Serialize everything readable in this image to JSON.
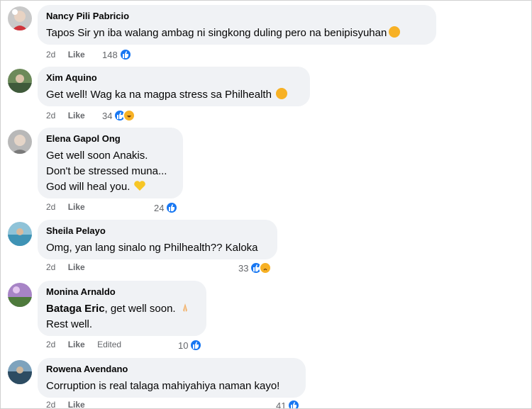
{
  "comments": [
    {
      "author": "Nancy Pili Pabricio",
      "lines": [
        "Tapos Sir yn iba walang ambag ni singkong duling pero na benipisyuhan"
      ],
      "time": "2d",
      "like": "Like",
      "count": "148",
      "reactions": [
        "like"
      ],
      "emoji": "crying-face"
    },
    {
      "author": "Xim Aquino",
      "lines": [
        "Get well! Wag ka na magpa stress sa Philhealth"
      ],
      "time": "2d",
      "like": "Like",
      "count": "34",
      "reactions": [
        "like",
        "haha"
      ],
      "emoji": "smiling-face"
    },
    {
      "author": "Elena Gapol Ong",
      "lines": [
        "Get well soon Anakis.",
        "Don't be stressed muna...",
        "God will heal you."
      ],
      "time": "2d",
      "like": "Like",
      "count": "24",
      "reactions": [
        "like"
      ],
      "emoji": "yellow-heart"
    },
    {
      "author": "Sheila Pelayo",
      "lines": [
        "Omg, yan lang sinalo ng Philhealth?? Kaloka"
      ],
      "time": "2d",
      "like": "Like",
      "count": "33",
      "reactions": [
        "like",
        "sad"
      ]
    },
    {
      "author": "Monina Arnaldo",
      "mention": "Bataga Eric",
      "lines": [
        ", get well soon.",
        "Rest well."
      ],
      "time": "2d",
      "like": "Like",
      "edited": "Edited",
      "count": "10",
      "reactions": [
        "like"
      ],
      "emoji": "folded-hands"
    },
    {
      "author": "Rowena Avendano",
      "lines": [
        "Corruption is real talaga mahiyahiya naman kayo!"
      ],
      "time": "2d",
      "like": "Like",
      "count": "41",
      "reactions": [
        "like"
      ]
    }
  ],
  "colors": {
    "like_blue": "#1877f2",
    "bubble": "#f0f2f5",
    "meta": "#65676b",
    "emoji_yellow": "#f7b125"
  }
}
